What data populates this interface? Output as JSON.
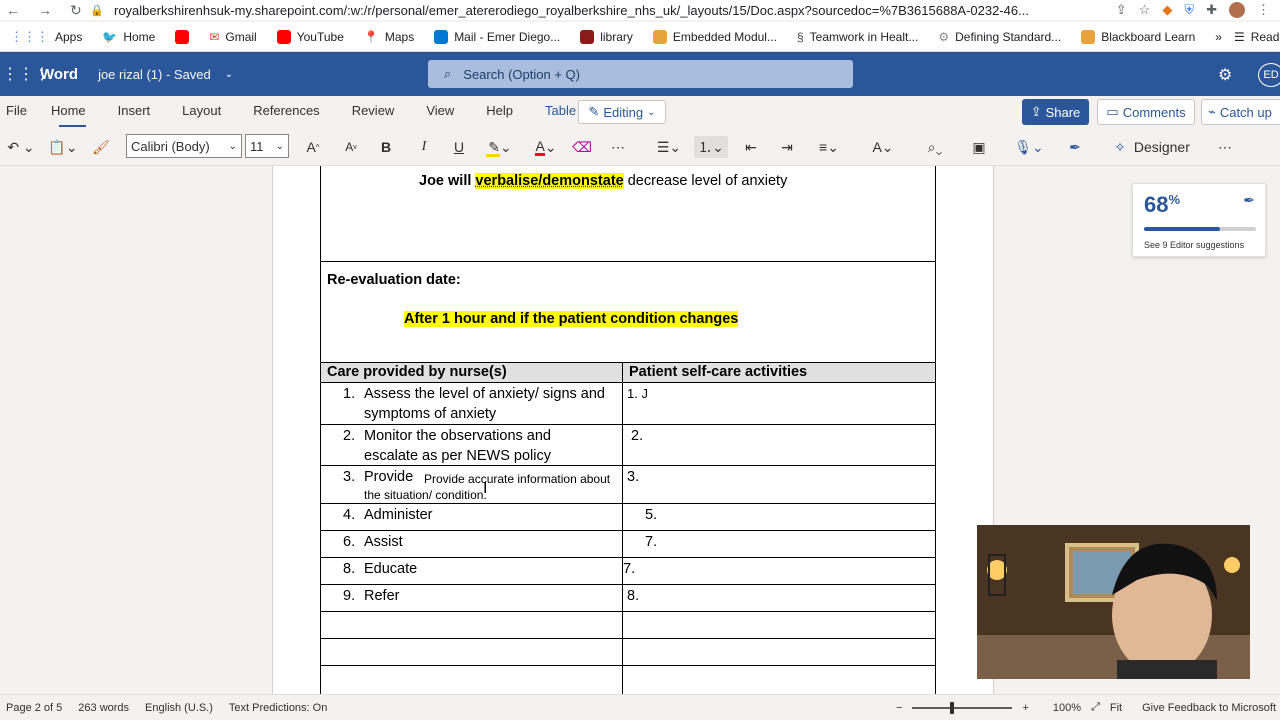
{
  "browser": {
    "url": "royalberkshirenhsuk-my.sharepoint.com/:w:/r/personal/emer_atererodiego_royalberkshire_nhs_uk/_layouts/15/Doc.aspx?sourcedoc=%7B3615688A-0232-46...",
    "bookmarks": [
      {
        "label": "Apps",
        "color": "#5f6368"
      },
      {
        "label": "Home",
        "color": "#1da1f2"
      },
      {
        "label": "",
        "color": "#ff0000"
      },
      {
        "label": "Gmail",
        "color": "#ea4335"
      },
      {
        "label": "YouTube",
        "color": "#ff0000"
      },
      {
        "label": "Maps",
        "color": "#34a853"
      },
      {
        "label": "Mail - Emer Diego...",
        "color": "#0078d4"
      },
      {
        "label": "library",
        "color": "#8b1a1a"
      },
      {
        "label": "Embedded Modul...",
        "color": "#e8a33d"
      },
      {
        "label": "Teamwork in Healt...",
        "color": "#444444"
      },
      {
        "label": "Defining Standard...",
        "color": "#888888"
      },
      {
        "label": "Blackboard Learn",
        "color": "#e8a33d"
      }
    ],
    "bookmarks_more": "»",
    "reading_list": "Reading List"
  },
  "word": {
    "app_name": "Word",
    "doc_title": "joe rizal (1)  -  Saved",
    "search_placeholder": "Search (Option + Q)",
    "avatar_initials": "ED",
    "tabs": [
      "File",
      "Home",
      "Insert",
      "Layout",
      "References",
      "Review",
      "View",
      "Help",
      "Table"
    ],
    "active_tab": "Home",
    "editing_label": "Editing",
    "share_label": "Share",
    "comments_label": "Comments",
    "catchup_label": "Catch up",
    "font_name": "Calibri (Body)",
    "font_size": "11",
    "designer_label": "Designer",
    "highlight_color": "#ffd500",
    "font_color": "#e81123",
    "accent": "#2b579a"
  },
  "document": {
    "goal_prefix": "Joe will ",
    "goal_highlight": "verbalise/demonstate",
    "goal_suffix": " decrease level of anxiety",
    "reeval_label": "Re-evaluation date:",
    "reeval_value": "After 1 hour and if the patient condition changes",
    "col1_header": "Care provided by nurse(s)",
    "col2_header": "Patient self-care activities",
    "rows": [
      {
        "n": "1.",
        "line1": "Assess the level of anxiety/ signs and",
        "line2": "symptoms of anxiety",
        "right": "1.  J"
      },
      {
        "n": "2.",
        "line1": "Monitor the observations and",
        "line2": "escalate as per NEWS policy",
        "right": "2."
      },
      {
        "n": "3.",
        "line1": "Provide",
        "small1": "Provide accurate information about",
        "small2": "the situation/ condition.",
        "right": "3."
      },
      {
        "n": "4.",
        "line1": "Administer",
        "right": "5."
      },
      {
        "n": "6.",
        "line1": "Assist",
        "right": "7."
      },
      {
        "n": "8.",
        "line1": "Educate",
        "right": "7."
      },
      {
        "n": "9.",
        "line1": "Refer",
        "right": "8."
      }
    ]
  },
  "editor": {
    "score": "68",
    "score_unit": "%",
    "progress": 0.68,
    "suggestions": "See 9 Editor suggestions",
    "suggestion_count": "9"
  },
  "status": {
    "page": "Page 2 of 5",
    "words": "263 words",
    "language": "English (U.S.)",
    "predictions": "Text Predictions: On",
    "zoom": "100%",
    "fit": "Fit",
    "feedback": "Give Feedback to Microsoft"
  }
}
